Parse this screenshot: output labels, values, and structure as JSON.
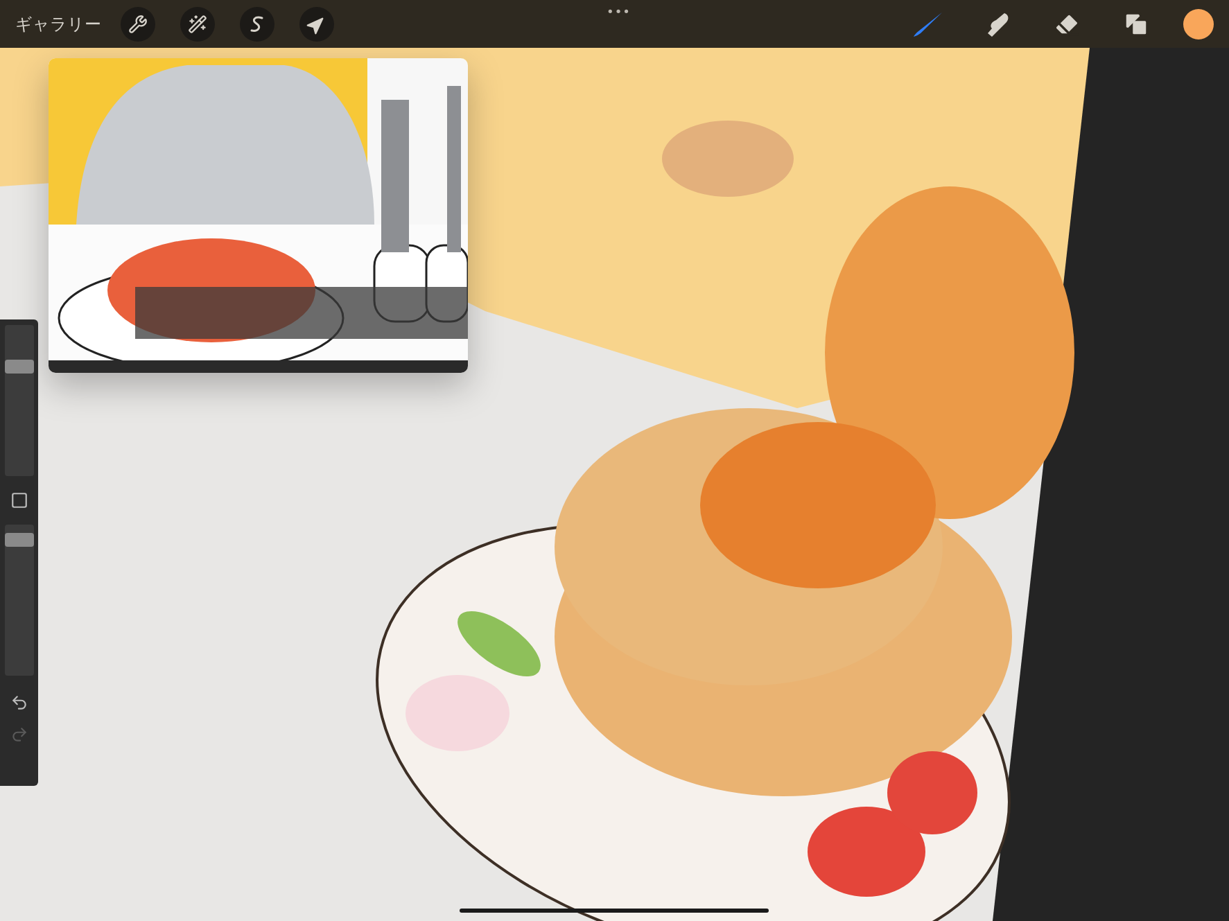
{
  "topbar": {
    "gallery_label": "ギャラリー",
    "more_label": "•••",
    "actions": [
      {
        "kind": "wrench"
      },
      {
        "kind": "wand"
      },
      {
        "kind": "selection"
      },
      {
        "kind": "transform"
      }
    ],
    "tools": [
      {
        "kind": "brush",
        "selected": true
      },
      {
        "kind": "smudge",
        "selected": false
      },
      {
        "kind": "eraser",
        "selected": false
      },
      {
        "kind": "layers",
        "selected": false
      }
    ],
    "color": "#f9a65a"
  },
  "sidebar": {
    "size_slider": {
      "level": 0.75
    },
    "opacity_slider": {
      "level": 0.94
    },
    "undo": {
      "disabled": false
    },
    "redo": {
      "disabled": true
    }
  }
}
